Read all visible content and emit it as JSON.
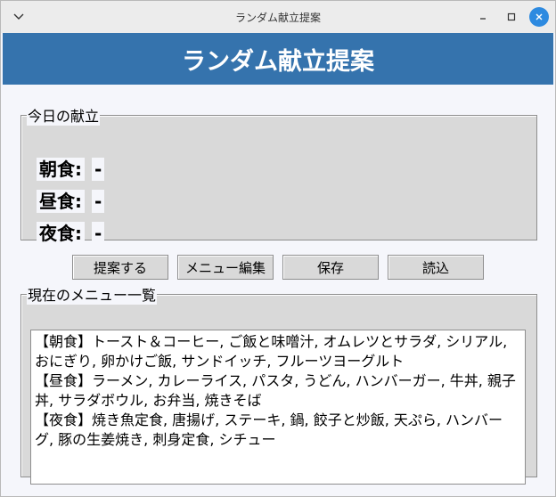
{
  "window": {
    "title": "ランダム献立提案"
  },
  "header": {
    "title": "ランダム献立提案"
  },
  "today": {
    "legend": "今日の献立",
    "meals": [
      {
        "label": "朝食:",
        "value": "-"
      },
      {
        "label": "昼食:",
        "value": "-"
      },
      {
        "label": "夜食:",
        "value": "-"
      }
    ]
  },
  "buttons": {
    "suggest": "提案する",
    "edit": "メニュー編集",
    "save": "保存",
    "load": "読込"
  },
  "menus": {
    "legend": "現在のメニュー一覧",
    "text": "【朝食】トースト＆コーヒー, ご飯と味噌汁, オムレツとサラダ, シリアル, おにぎり, 卵かけご飯, サンドイッチ, フルーツヨーグルト\n【昼食】ラーメン, カレーライス, パスタ, うどん, ハンバーガー, 牛丼, 親子丼, サラダボウル, お弁当, 焼きそば\n【夜食】焼き魚定食, 唐揚げ, ステーキ, 鍋, 餃子と炒飯, 天ぷら, ハンバーグ, 豚の生姜焼き, 刺身定食, シチュー"
  },
  "icons": {
    "window_menu": "chevron-down-icon",
    "minimize": "minimize-icon",
    "maximize": "maximize-icon",
    "close": "close-icon"
  },
  "colors": {
    "header_bg": "#3573ad",
    "close_button": "#2d8ae0"
  }
}
